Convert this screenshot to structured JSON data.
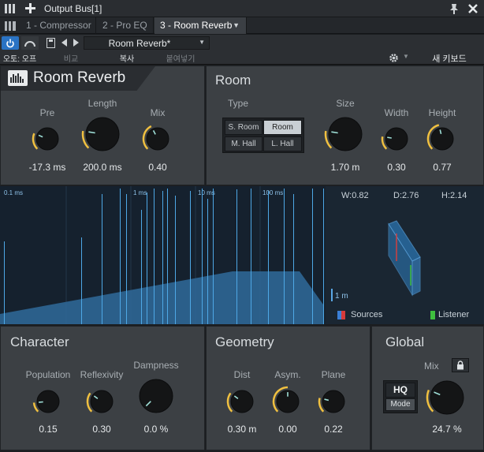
{
  "titlebar": {
    "menu_icon": "menu-icon",
    "add_icon": "plus-icon",
    "title": "Output Bus[1]",
    "pin_icon": "pin-icon",
    "close_icon": "close-icon"
  },
  "tabs": [
    {
      "label": "1 - Compressor"
    },
    {
      "label": "2 - Pro EQ"
    },
    {
      "label": "3 - Room Reverb"
    }
  ],
  "toolbar": {
    "preset_name": "Room Reverb*",
    "auto_label": "오토: 오프",
    "compare_label": "비교",
    "copy_label": "복사",
    "paste_label": "붙여넣기",
    "new_keyboard_label": "새 키보드"
  },
  "room_reverb": {
    "title": "Room Reverb",
    "pre": {
      "label": "Pre",
      "value": "-17.3 ms",
      "level": 0.25
    },
    "length": {
      "label": "Length",
      "value": "200.0 ms",
      "level": 0.2
    },
    "mix": {
      "label": "Mix",
      "value": "0.40",
      "level": 0.4
    }
  },
  "room": {
    "title": "Room",
    "type_label": "Type",
    "types": [
      {
        "label": "S. Room",
        "selected": false
      },
      {
        "label": "Room",
        "selected": true
      },
      {
        "label": "M. Hall",
        "selected": false
      },
      {
        "label": "L. Hall",
        "selected": false
      }
    ],
    "size": {
      "label": "Size",
      "value": "1.70 m",
      "level": 0.2
    },
    "width": {
      "label": "Width",
      "value": "0.30",
      "level": 0.2
    },
    "height": {
      "label": "Height",
      "value": "0.77",
      "level": 0.45
    }
  },
  "display": {
    "ms_labels": [
      "0.1 ms",
      "1 ms",
      "10 ms",
      "100 ms"
    ],
    "w": "W:0.82",
    "d": "D:2.76",
    "h": "H:2.14",
    "scale": "1 m",
    "sources": "Sources",
    "listener": "Listener",
    "sources_color": "#3a7fd6",
    "sources_color2": "#d63a3a",
    "listener_color": "#3fbf3f"
  },
  "character": {
    "title": "Character",
    "population": {
      "label": "Population",
      "value": "0.15",
      "level": 0.15
    },
    "reflexivity": {
      "label": "Reflexivity",
      "value": "0.30",
      "level": 0.3
    },
    "dampness": {
      "label": "Dampness",
      "value": "0.0 %",
      "level": 0.0
    }
  },
  "geometry": {
    "title": "Geometry",
    "dist": {
      "label": "Dist",
      "value": "0.30 m",
      "level": 0.3
    },
    "asym": {
      "label": "Asym.",
      "value": "0.00",
      "level": 0.5
    },
    "plane": {
      "label": "Plane",
      "value": "0.22",
      "level": 0.22
    }
  },
  "global": {
    "title": "Global",
    "mix_label": "Mix",
    "mix_value": "24.7 %",
    "mix_level": 0.25,
    "hq_label": "HQ",
    "mode_label": "Mode"
  },
  "accent_color": "#f0c040"
}
